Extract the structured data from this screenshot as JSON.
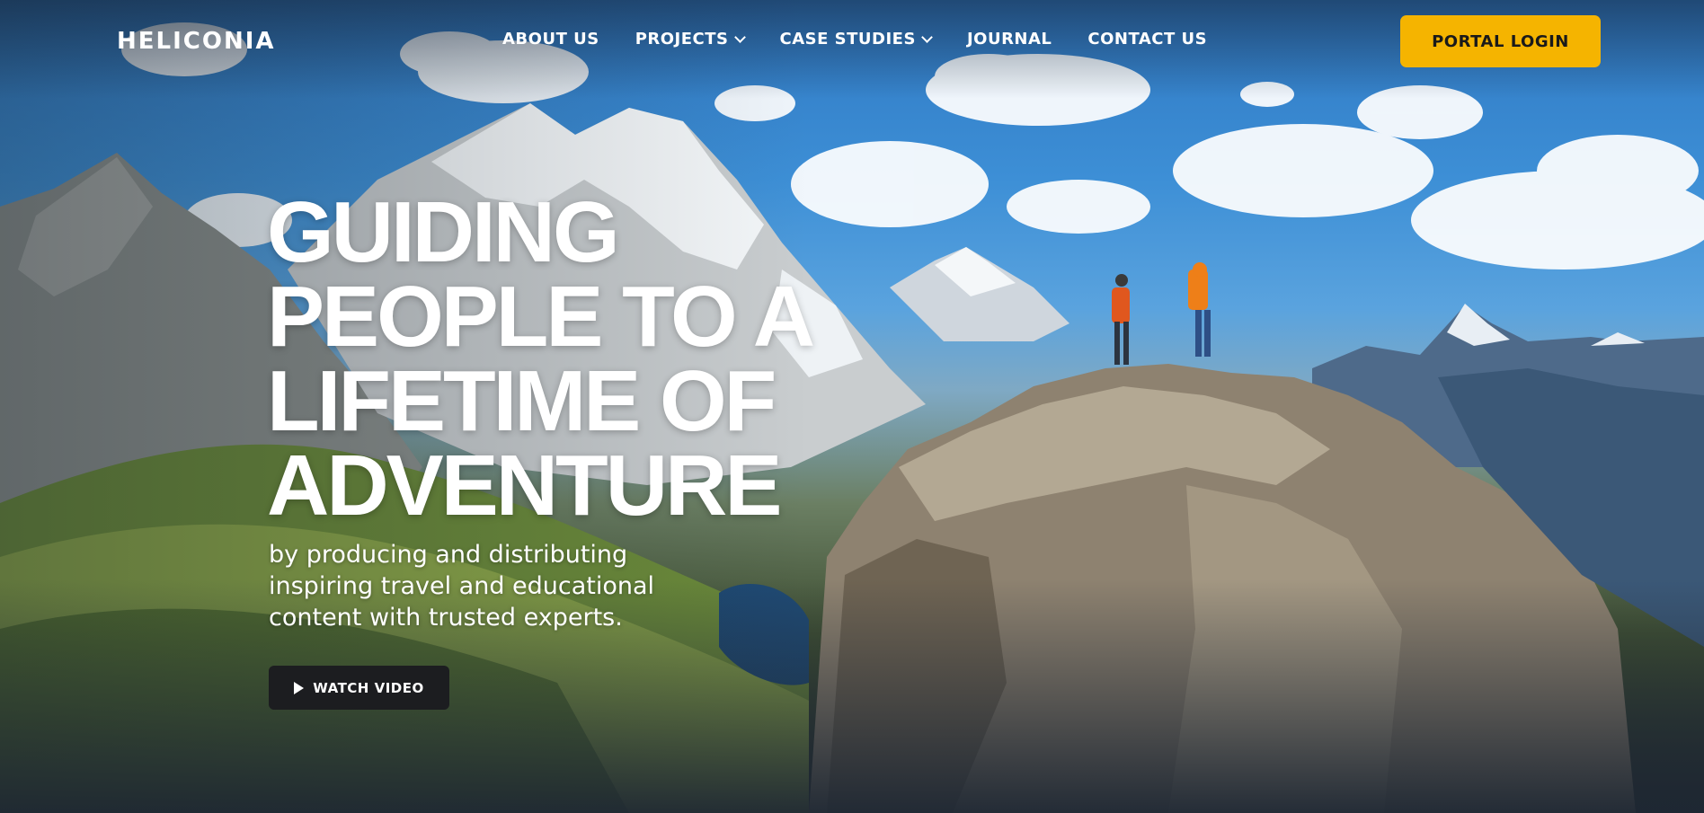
{
  "brand": {
    "logo_text": "HELICONIA"
  },
  "nav": {
    "items": [
      {
        "label": "ABOUT US",
        "dropdown": false
      },
      {
        "label": "PROJECTS",
        "dropdown": true
      },
      {
        "label": "CASE STUDIES",
        "dropdown": true
      },
      {
        "label": "JOURNAL",
        "dropdown": false
      },
      {
        "label": "CONTACT US",
        "dropdown": false
      }
    ],
    "portal_label": "PORTAL LOGIN"
  },
  "hero": {
    "headline_lines": [
      "GUIDING",
      "PEOPLE TO A",
      "LIFETIME OF",
      "ADVENTURE"
    ],
    "subtitle_lines": [
      "by producing and distributing",
      "inspiring travel and educational",
      "content with trusted experts."
    ],
    "watch_label": "WATCH VIDEO",
    "background": "mountain-hikers-photo"
  },
  "colors": {
    "accent": "#f5b400",
    "button_dark": "#1c1d20",
    "text": "#ffffff"
  },
  "icons": {
    "dropdown": "chevron-down-icon",
    "play": "play-icon"
  }
}
